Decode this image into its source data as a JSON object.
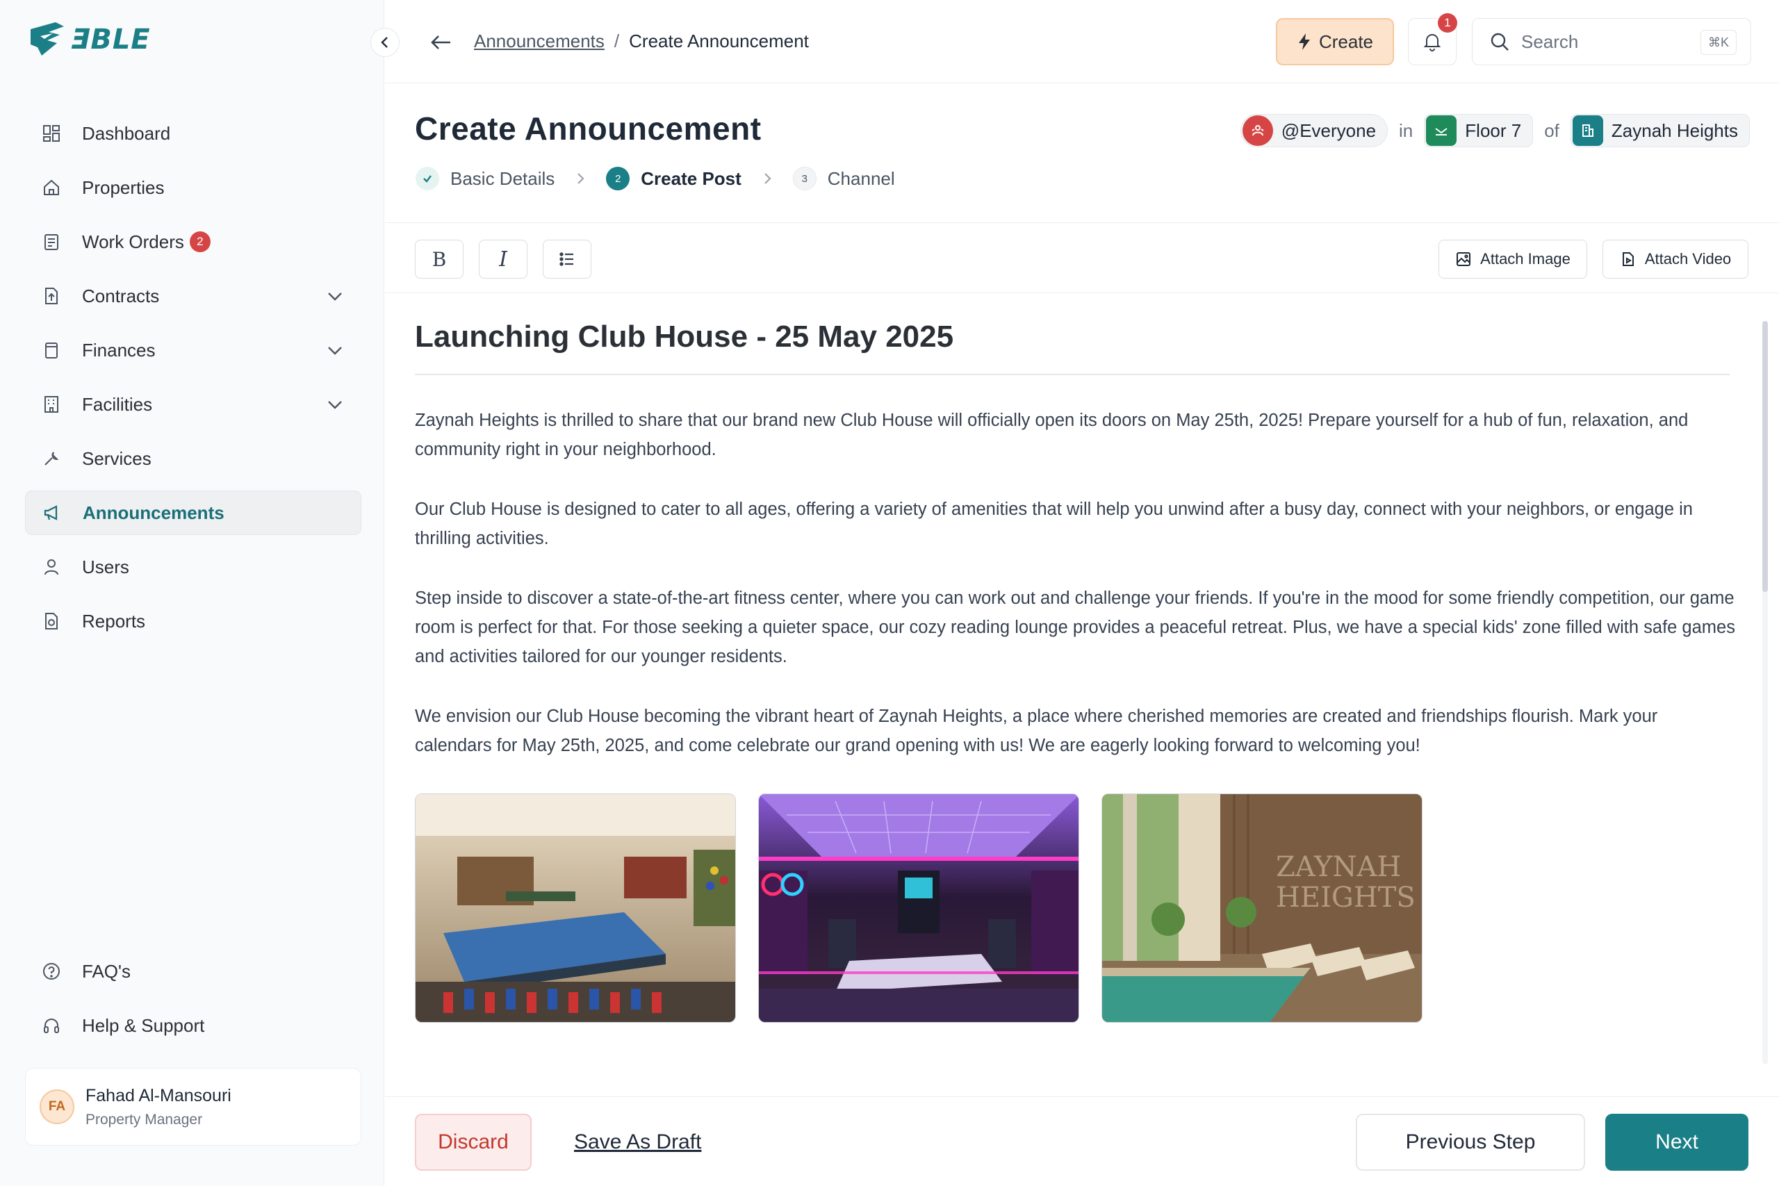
{
  "app": {
    "logo_text": "ƎBLE",
    "accent": "#1a7f86"
  },
  "sidebar": {
    "items": [
      {
        "label": "Dashboard",
        "icon": "dashboard-icon"
      },
      {
        "label": "Properties",
        "icon": "home-icon"
      },
      {
        "label": "Work Orders",
        "icon": "clipboard-icon",
        "badge": "2"
      },
      {
        "label": "Contracts",
        "icon": "contract-icon",
        "expandable": true
      },
      {
        "label": "Finances",
        "icon": "wallet-icon",
        "expandable": true
      },
      {
        "label": "Facilities",
        "icon": "building-icon",
        "expandable": true
      },
      {
        "label": "Services",
        "icon": "wrench-icon"
      },
      {
        "label": "Announcements",
        "icon": "megaphone-icon",
        "active": true
      },
      {
        "label": "Users",
        "icon": "user-icon"
      },
      {
        "label": "Reports",
        "icon": "report-icon"
      }
    ],
    "bottom_items": [
      {
        "label": "FAQ's",
        "icon": "question-icon"
      },
      {
        "label": "Help & Support",
        "icon": "headset-icon"
      }
    ],
    "user": {
      "initials": "FA",
      "name": "Fahad Al-Mansouri",
      "role": "Property Manager"
    }
  },
  "header": {
    "breadcrumb_parent": "Announcements",
    "breadcrumb_separator": "/",
    "breadcrumb_current": "Create Announcement",
    "create_label": "Create",
    "notification_count": "1",
    "search_placeholder": "Search",
    "search_shortcut": "⌘K"
  },
  "page": {
    "title": "Create Announcement",
    "audience": {
      "group": "@Everyone",
      "in_word": "in",
      "floor": "Floor 7",
      "of_word": "of",
      "property": "Zaynah Heights"
    },
    "steps": [
      {
        "number": "1",
        "label": "Basic Details",
        "state": "done"
      },
      {
        "number": "2",
        "label": "Create Post",
        "state": "active"
      },
      {
        "number": "3",
        "label": "Channel",
        "state": "pending"
      }
    ]
  },
  "toolbar": {
    "bold_label": "B",
    "italic_label": "I",
    "attach_image_label": "Attach Image",
    "attach_video_label": "Attach Video"
  },
  "post": {
    "title": "Launching Club House - 25 May 2025",
    "paragraphs": [
      "Zaynah Heights is thrilled to share that our brand new Club House will officially open its doors on May 25th, 2025! Prepare yourself for a hub of fun, relaxation, and community right in your neighborhood.",
      "Our Club House is designed to cater to all ages, offering a variety of amenities that will help you unwind after a busy day, connect with your neighbors, or engage in thrilling activities.",
      "Step inside to discover a state-of-the-art fitness center, where you can work out and challenge your friends. If you're in the mood for some friendly competition, our game room is perfect for that. For those seeking a quieter space, our cozy reading lounge provides a peaceful retreat. Plus, we have a special kids' zone filled with safe games and activities tailored for our younger residents.",
      "We envision our Club House becoming the vibrant heart of Zaynah Heights, a place where cherished memories are created and friendships flourish. Mark your calendars for May 25th, 2025, and come celebrate our grand opening with us! We are eagerly looking forward to welcoming you!"
    ],
    "images": [
      "game-room-image",
      "arcade-room-image",
      "pool-lounge-image"
    ],
    "image_wall_text": [
      "ZAYNAH",
      "HEIGHTS"
    ]
  },
  "footer": {
    "discard_label": "Discard",
    "draft_label": "Save As Draft",
    "prev_label": "Previous Step",
    "next_label": "Next"
  }
}
